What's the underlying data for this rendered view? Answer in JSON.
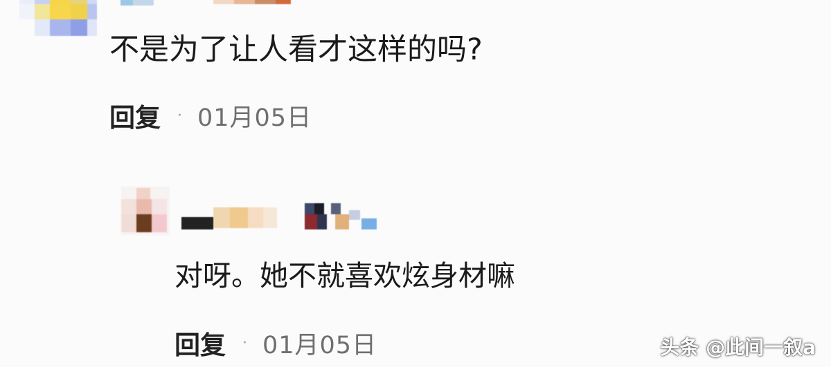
{
  "comment": {
    "text": "不是为了让人看才这样的吗?",
    "reply_label": "回复",
    "separator": "·",
    "date": "01月05日"
  },
  "reply": {
    "text": "对呀。她不就喜欢炫身材嘛",
    "reply_label": "回复",
    "separator": "·",
    "date": "01月05日"
  },
  "watermark": "头条 @此间一叙a",
  "colors": {
    "background": "#fbfbfb",
    "text": "#1a1a1a",
    "meta": "#6f6f6f"
  }
}
